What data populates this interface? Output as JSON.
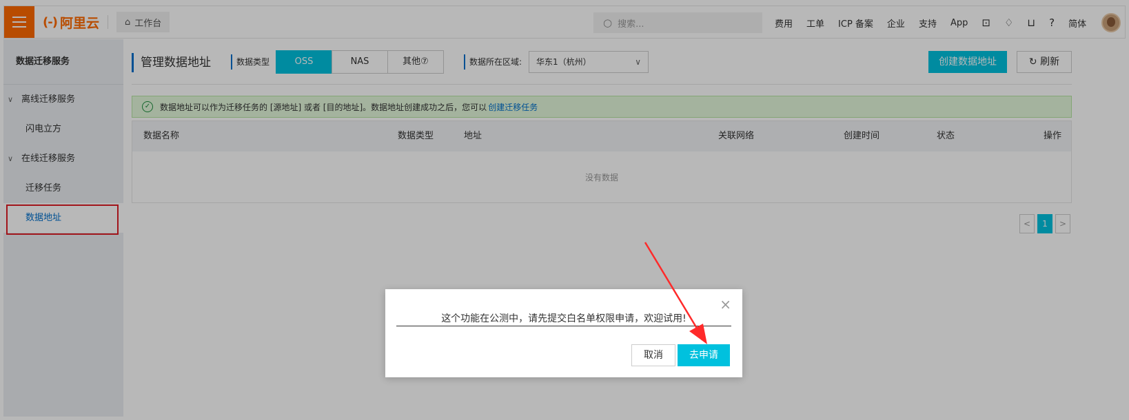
{
  "topbar": {
    "logo_mark": "(-)",
    "logo_text": "阿里云",
    "workbench": "工作台",
    "search_placeholder": "搜索...",
    "nav": [
      "费用",
      "工单",
      "ICP 备案",
      "企业",
      "支持",
      "App"
    ],
    "lang": "简体"
  },
  "sidebar": {
    "title": "数据迁移服务",
    "group1": "离线迁移服务",
    "group1_items": [
      "闪电立方"
    ],
    "group2": "在线迁移服务",
    "group2_items": [
      "迁移任务",
      "数据地址"
    ]
  },
  "main": {
    "page_title": "管理数据地址",
    "type_label": "数据类型",
    "types": [
      "OSS",
      "NAS",
      "其他⑦"
    ],
    "region_label": "数据所在区域:",
    "region_value": "华东1（杭州）",
    "create_button": "创建数据地址",
    "refresh_button": "刷新",
    "notice_text": "数据地址可以作为迁移任务的 [源地址] 或者 [目的地址]。数据地址创建成功之后，您可以",
    "notice_link": "创建迁移任务",
    "columns": [
      "数据名称",
      "数据类型",
      "地址",
      "关联网络",
      "创建时间",
      "状态",
      "操作"
    ],
    "empty_text": "没有数据",
    "pager_current": "1"
  },
  "dialog": {
    "message": "这个功能在公测中，请先提交白名单权限申请，欢迎试用!",
    "cancel": "取消",
    "apply": "去申请"
  }
}
